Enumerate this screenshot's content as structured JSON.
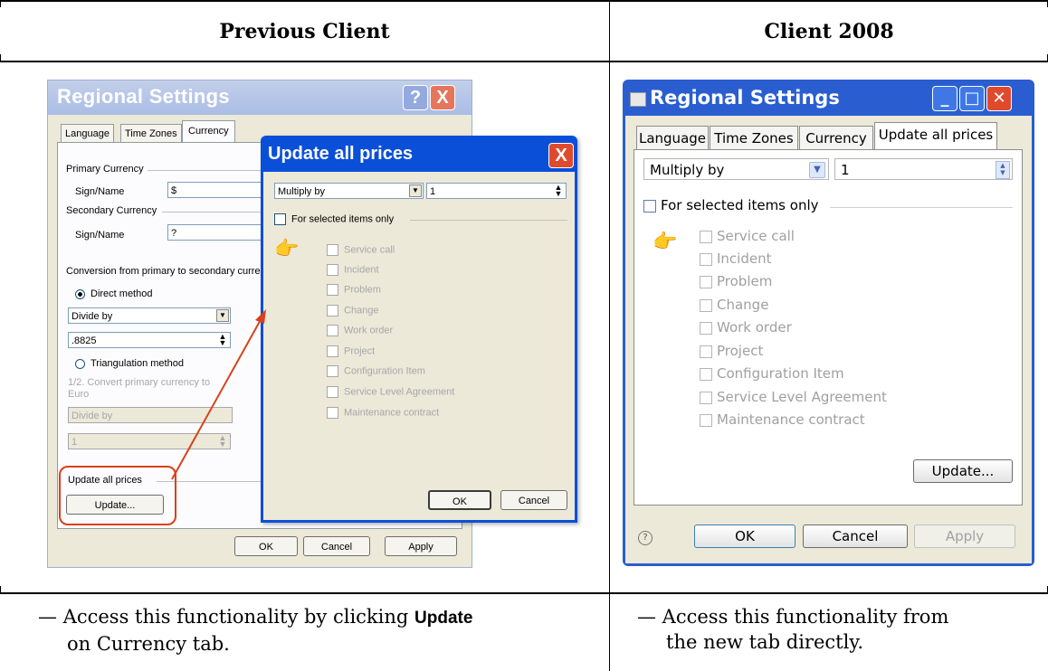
{
  "columns": {
    "left_heading": "Previous Client",
    "right_heading": "Client 2008"
  },
  "notes": {
    "left_prefix": "— Access this functionality by clicking ",
    "left_bold": "Update",
    "left_line2": "on Currency tab.",
    "right_line1": "— Access this functionality from",
    "right_line2": "the new tab directly."
  },
  "classic_dialog": {
    "title": "Regional Settings",
    "help_button": "?",
    "close_button": "X",
    "tabs": [
      "Language",
      "Time Zones",
      "Currency"
    ],
    "primary_currency_group": "Primary Currency",
    "primary_sign_label": "Sign/Name",
    "primary_sign_value": "$",
    "secondary_currency_group": "Secondary Currency",
    "secondary_sign_label": "Sign/Name",
    "secondary_sign_value": "?",
    "conversion_label": "Conversion from primary to secondary curre",
    "direct_method": "Direct method",
    "divide_select": "Divide by",
    "rate_value": ".8825",
    "triangulation_method": "Triangulation method",
    "convert_label_1": "1/2. Convert primary currency to",
    "convert_label_2": "Euro",
    "divide_select_disabled": "Divide by",
    "rate_disabled": "1",
    "update_group": "Update all prices",
    "update_button": "Update...",
    "ok": "OK",
    "cancel": "Cancel",
    "apply": "Apply"
  },
  "classic_popup": {
    "title": "Update all prices",
    "close_button": "X",
    "operation_select": "Multiply by",
    "factor_value": "1",
    "selected_only": "For selected items only",
    "items": [
      "Service call",
      "Incident",
      "Problem",
      "Change",
      "Work order",
      "Project",
      "Configuration Item",
      "Service Level Agreement",
      "Maintenance contract"
    ],
    "ok": "OK",
    "cancel": "Cancel"
  },
  "modern_dialog": {
    "title": "Regional Settings",
    "tabs": [
      "Language",
      "Time Zones",
      "Currency",
      "Update all prices"
    ],
    "operation_select": "Multiply by",
    "factor_value": "1",
    "selected_only": "For selected items only",
    "items": [
      "Service call",
      "Incident",
      "Problem",
      "Change",
      "Work order",
      "Project",
      "Configuration Item",
      "Service Level Agreement",
      "Maintenance contract"
    ],
    "update_button": "Update...",
    "help": "?",
    "ok": "OK",
    "cancel": "Cancel",
    "apply": "Apply"
  },
  "colors": {
    "annotation_red": "#d9401c",
    "xp_blue": "#0a4fd8",
    "close_red": "#e04a2c"
  }
}
